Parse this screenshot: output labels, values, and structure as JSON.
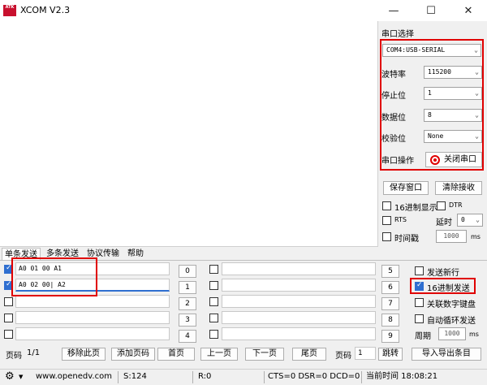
{
  "window": {
    "logo_text": "ATK",
    "title": "XCOM V2.3",
    "minimize": "—",
    "maximize": "☐",
    "close": "✕"
  },
  "serial": {
    "section_label": "串口选择",
    "port": "COM4:USB-SERIAL",
    "baud_label": "波特率",
    "baud": "115200",
    "stop_label": "停止位",
    "stop": "1",
    "data_label": "数据位",
    "data": "8",
    "parity_label": "校验位",
    "parity": "None",
    "op_label": "串口操作",
    "open_button": "关闭串口"
  },
  "receive": {
    "save_button": "保存窗口",
    "clear_button": "清除接收",
    "hex_display": "16进制显示",
    "dtr": "DTR",
    "rts": "RTS",
    "delay_label": "延时",
    "delay_value": "0",
    "timestamp": "时间戳",
    "timestamp_value": "1000",
    "ms": "ms"
  },
  "tabs": [
    "单条发送",
    "多条发送",
    "协议传输",
    "帮助"
  ],
  "send_rows": [
    {
      "text": "A0 01 00 A1",
      "checked": true,
      "button": "0"
    },
    {
      "text": "A0 02 00| A2",
      "checked": true,
      "button": "1"
    },
    {
      "text": "",
      "checked": false,
      "button": "2"
    },
    {
      "text": "",
      "checked": false,
      "button": "3"
    },
    {
      "text": "",
      "checked": false,
      "button": "4"
    }
  ],
  "send_rows_right": [
    {
      "text": "",
      "button": "5"
    },
    {
      "text": "",
      "button": "6"
    },
    {
      "text": "",
      "button": "7"
    },
    {
      "text": "",
      "button": "8"
    },
    {
      "text": "",
      "button": "9"
    }
  ],
  "send_options": {
    "newline": "发送新行",
    "hex_send": "16进制发送",
    "keyboard": "关联数字键盘",
    "loop": "自动循环发送",
    "period_label": "周期",
    "period_value": "1000",
    "ms": "ms"
  },
  "pager": {
    "page_label": "页码",
    "page_value": "1/1",
    "remove": "移除此页",
    "add": "添加页码",
    "first": "首页",
    "prev": "上一页",
    "next": "下一页",
    "last": "尾页",
    "goto_label": "页码",
    "goto_value": "1",
    "jump": "跳转",
    "import_export": "导入导出条目"
  },
  "status": {
    "gear": "⚙",
    "url": "www.openedv.com",
    "sent": "S:124",
    "recv": "R:0",
    "signals": "CTS=0 DSR=0 DCD=0",
    "time": "当前时间 18:08:21"
  },
  "colors": {
    "highlight_red": "#e00000",
    "checkbox_blue": "#2f6fd0",
    "logo_red": "#c8102e"
  }
}
